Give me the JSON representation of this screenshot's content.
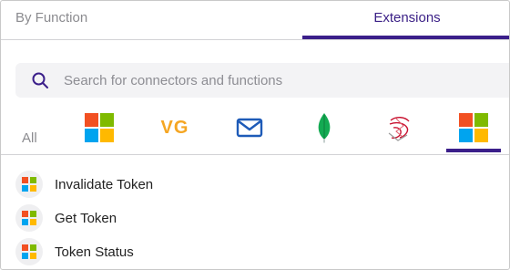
{
  "tabs": {
    "by_function": "By Function",
    "extensions": "Extensions"
  },
  "search": {
    "placeholder": "Search for connectors and functions"
  },
  "filters": {
    "all": "All",
    "icons": [
      "microsoft-icon",
      "vg-icon",
      "mail-icon",
      "mongodb-icon",
      "sql-server-icon",
      "microsoft-icon"
    ],
    "active_index": 5,
    "vg_text": "VG"
  },
  "functions": [
    {
      "label": "Invalidate Token",
      "icon": "microsoft-icon"
    },
    {
      "label": "Get Token",
      "icon": "microsoft-icon"
    },
    {
      "label": "Token Status",
      "icon": "microsoft-icon"
    }
  ],
  "colors": {
    "accent": "#3b1f8a",
    "tab_active_text": "#3a1f86",
    "vg_orange": "#f5a623",
    "mail_blue": "#1e5bb8",
    "mongodb_green": "#13aa52",
    "sql_red": "#c8102e"
  }
}
